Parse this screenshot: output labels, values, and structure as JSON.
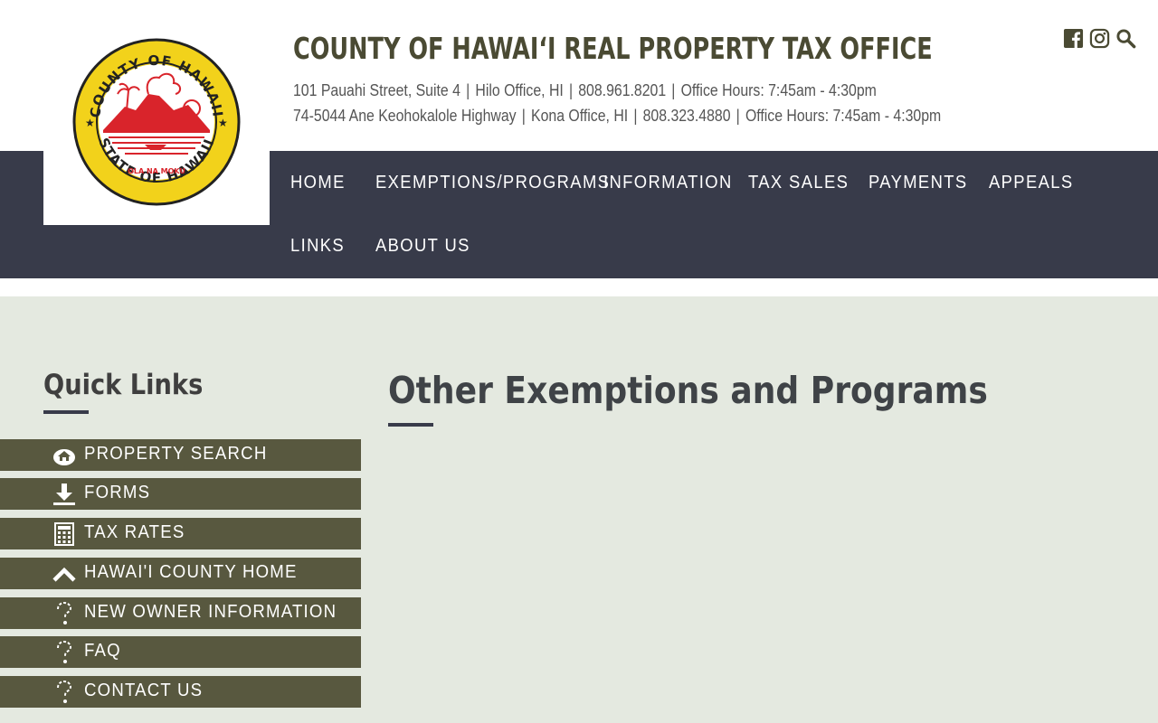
{
  "header": {
    "title": "COUNTY OF HAWAIʻI REAL PROPERTY TAX OFFICE",
    "hilo": {
      "address": "101 Pauahi Street, Suite 4",
      "office": "Hilo Office, HI",
      "phone": "808.961.8201",
      "hours": "Office Hours: 7:45am - 4:30pm"
    },
    "kona": {
      "address": "74-5044 Ane Keohokalole Highway",
      "office": "Kona Office, HI",
      "phone": "808.323.4880",
      "hours": "Office Hours: 7:45am - 4:30pm"
    },
    "separator": "|",
    "social_icons": [
      "facebook-icon",
      "instagram-icon",
      "search-icon"
    ]
  },
  "logo": {
    "seal_top_text": "COUNTY OF HAWAII",
    "seal_bottom_text": "STATE OF HAWAII",
    "seal_motto": "OLA NA MOKU",
    "colors": {
      "ring": "#f2d21b",
      "art": "#d9242b",
      "border": "#222222"
    }
  },
  "nav": {
    "items": [
      {
        "label": "HOME"
      },
      {
        "label": "EXEMPTIONS/PROGRAMS"
      },
      {
        "label": "INFORMATION"
      },
      {
        "label": "TAX SALES"
      },
      {
        "label": "PAYMENTS"
      },
      {
        "label": "APPEALS"
      },
      {
        "label": "LINKS"
      },
      {
        "label": "ABOUT US"
      }
    ]
  },
  "quick_links": {
    "title": "Quick Links",
    "items": [
      {
        "label": "PROPERTY SEARCH",
        "icon": "property-search-icon"
      },
      {
        "label": "FORMS",
        "icon": "download-icon"
      },
      {
        "label": "TAX RATES",
        "icon": "calculator-icon"
      },
      {
        "label": "HAWAI'I COUNTY HOME",
        "icon": "chevron-up-icon"
      },
      {
        "label": "NEW OWNER INFORMATION",
        "icon": "question-icon"
      },
      {
        "label": "FAQ",
        "icon": "question-icon"
      },
      {
        "label": "CONTACT US",
        "icon": "question-icon"
      }
    ]
  },
  "main": {
    "page_title": "Other Exemptions and Programs"
  },
  "colors": {
    "nav_bg": "#383b4a",
    "main_bg": "#e4e9e0",
    "quick_link_bg": "#58583f",
    "title_color": "#4a4a33"
  }
}
